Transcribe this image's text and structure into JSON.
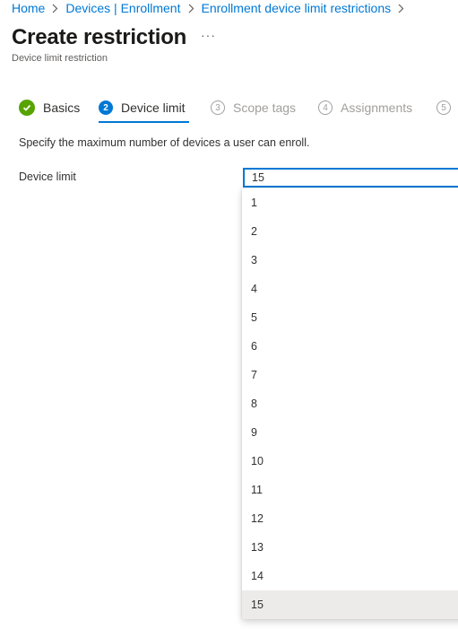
{
  "breadcrumb": {
    "items": [
      "Home",
      "Devices | Enrollment",
      "Enrollment device limit restrictions"
    ]
  },
  "header": {
    "title": "Create restriction",
    "more": "···",
    "subtitle": "Device limit restriction"
  },
  "wizard": {
    "steps": [
      {
        "number": "",
        "label": "Basics",
        "state": "completed"
      },
      {
        "number": "2",
        "label": "Device limit",
        "state": "active"
      },
      {
        "number": "3",
        "label": "Scope tags",
        "state": "pending"
      },
      {
        "number": "4",
        "label": "Assignments",
        "state": "pending"
      },
      {
        "number": "5",
        "label": "",
        "state": "pending"
      }
    ]
  },
  "content": {
    "description": "Specify the maximum number of devices a user can enroll.",
    "field_label": "Device limit",
    "selected_value": "15",
    "options": [
      "1",
      "2",
      "3",
      "4",
      "5",
      "6",
      "7",
      "8",
      "9",
      "10",
      "11",
      "12",
      "13",
      "14",
      "15"
    ]
  },
  "colors": {
    "accent": "#0078d4",
    "completed": "#57a300",
    "pending": "#a19f9d",
    "selected_option_bg": "#edebe9"
  },
  "icons": [
    "chevron-right-icon",
    "checkmark-icon",
    "more-icon"
  ]
}
